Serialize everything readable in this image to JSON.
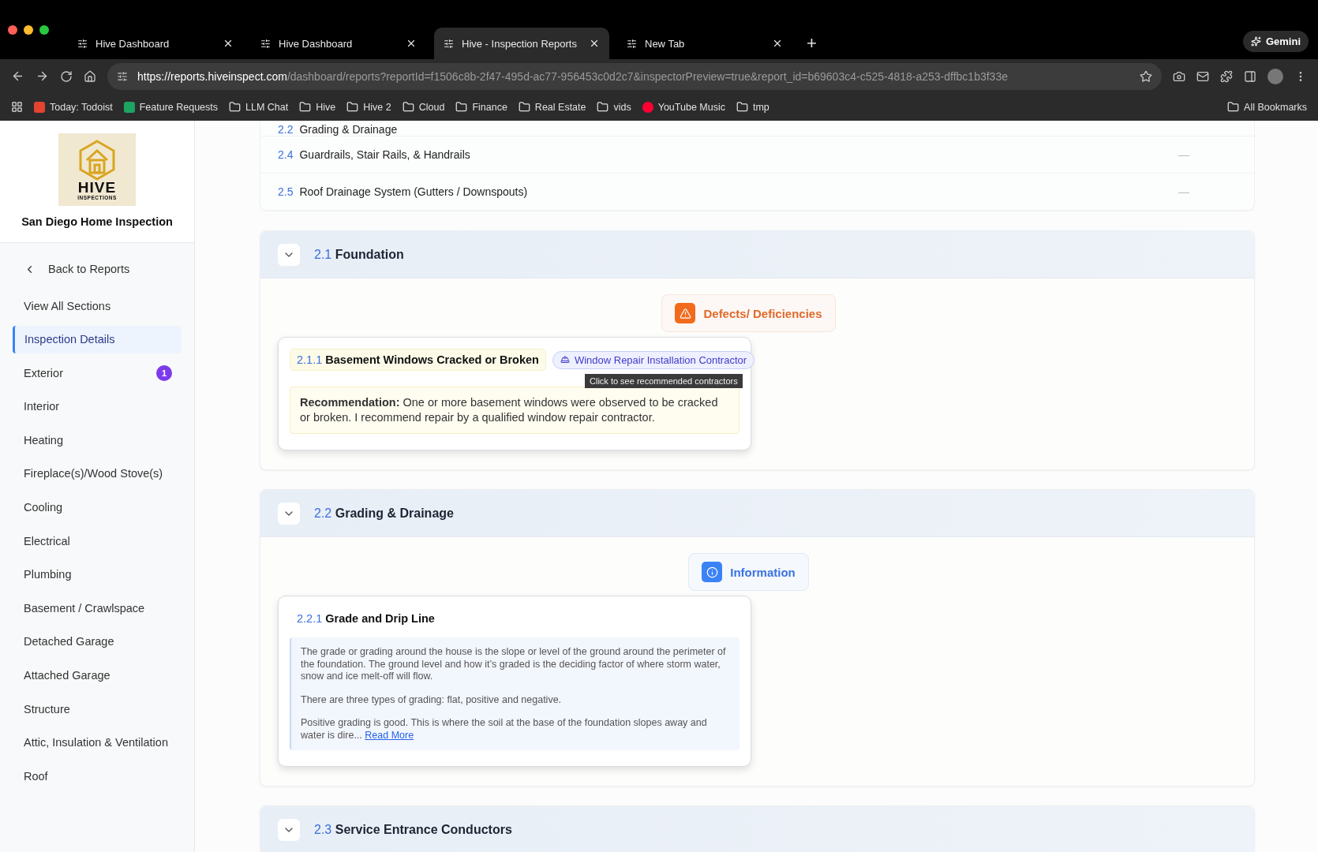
{
  "browser": {
    "tabs": [
      {
        "title": "Hive Dashboard",
        "selected": false
      },
      {
        "title": "Hive Dashboard",
        "selected": false
      },
      {
        "title": "Hive - Inspection Reports",
        "selected": true
      },
      {
        "title": "New Tab",
        "selected": false
      }
    ],
    "new_tab": "+",
    "assistant": "Gemini",
    "url": {
      "host": "https://reports.hiveinspect.com",
      "path": "/dashboard/reports?reportId=f1506c8b-2f47-495d-ac77-956453c0d2c7&inspectorPreview=true&report_id=b69603c4-c525-4818-a253-dffbc1b3f33e"
    },
    "bookmarks": [
      {
        "label": "Today: Todoist",
        "kind": "todoist"
      },
      {
        "label": "Feature Requests",
        "kind": "sheet"
      },
      {
        "label": "LLM Chat",
        "kind": "folder"
      },
      {
        "label": "Hive",
        "kind": "folder"
      },
      {
        "label": "Hive 2",
        "kind": "folder"
      },
      {
        "label": "Cloud",
        "kind": "folder"
      },
      {
        "label": "Finance",
        "kind": "folder"
      },
      {
        "label": "Real Estate",
        "kind": "folder"
      },
      {
        "label": "vids",
        "kind": "folder"
      },
      {
        "label": "YouTube Music",
        "kind": "music"
      },
      {
        "label": "tmp",
        "kind": "folder"
      }
    ],
    "all_bookmarks": "All Bookmarks"
  },
  "sidebar": {
    "logo": {
      "word": "HIVE",
      "sub": "INSPECTIONS"
    },
    "company": "San Diego Home Inspection",
    "back": "Back to Reports",
    "items": [
      {
        "label": "View All Sections",
        "selected": false
      },
      {
        "label": "Inspection Details",
        "selected": true
      },
      {
        "label": "Exterior",
        "selected": false,
        "badge": "1"
      },
      {
        "label": "Interior",
        "selected": false
      },
      {
        "label": "Heating",
        "selected": false
      },
      {
        "label": "Fireplace(s)/Wood Stove(s)",
        "selected": false
      },
      {
        "label": "Cooling",
        "selected": false
      },
      {
        "label": "Electrical",
        "selected": false
      },
      {
        "label": "Plumbing",
        "selected": false
      },
      {
        "label": "Basement / Crawlspace",
        "selected": false
      },
      {
        "label": "Detached Garage",
        "selected": false
      },
      {
        "label": "Attached Garage",
        "selected": false
      },
      {
        "label": "Structure",
        "selected": false
      },
      {
        "label": "Attic, Insulation & Ventilation",
        "selected": false
      },
      {
        "label": "Roof",
        "selected": false
      }
    ]
  },
  "summary_rows": [
    {
      "number": "2.2",
      "title": "Grading & Drainage"
    },
    {
      "number": "2.4",
      "title": "Guardrails, Stair Rails, & Handrails",
      "status": "—"
    },
    {
      "number": "2.5",
      "title": "Roof Drainage System (Gutters / Downspouts)",
      "status": "—"
    }
  ],
  "sections": [
    {
      "number": "2.1",
      "title": "Foundation",
      "expanded": true,
      "category": {
        "kind": "defect",
        "label": "Defects/ Deficiencies"
      },
      "items": [
        {
          "kind": "recommendation",
          "number": "2.1.1",
          "title": "Basement Windows Cracked or Broken",
          "contractor": "Window Repair Installation Contractor",
          "tooltip": "Click to see recommended contractors",
          "paragraphs": [
            "**Recommendation:** One or more basement windows were observed to be cracked or broken. I recommend repair by a qualified window repair contractor."
          ]
        }
      ]
    },
    {
      "number": "2.2",
      "title": "Grading & Drainage",
      "expanded": true,
      "category": {
        "kind": "info",
        "label": "Information"
      },
      "items": [
        {
          "kind": "info",
          "number": "2.2.1",
          "title": "Grade and Drip Line",
          "paragraphs": [
            "The grade or grading around the house is the slope or level of the ground around the perimeter of the foundation. The ground level and how it’s graded is the deciding factor of where storm water, snow and ice melt-off will flow.",
            "There are three types of grading: flat, positive and negative.",
            "Positive grading is good. This is where the soil at the base of the foundation slopes away and water is dire..."
          ],
          "more": "Read More"
        }
      ]
    },
    {
      "number": "2.3",
      "title": "Service Entrance Conductors",
      "expanded": true
    }
  ]
}
